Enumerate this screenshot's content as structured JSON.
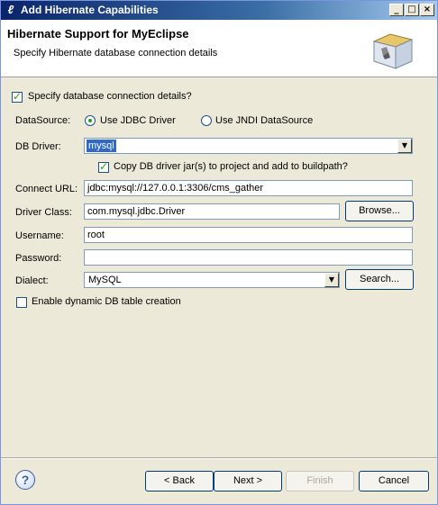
{
  "window": {
    "title": "Add Hibernate Capabilities",
    "controls": {
      "minimize": "_",
      "maximize": "□",
      "close": "×"
    }
  },
  "banner": {
    "heading": "Hibernate Support for MyEclipse",
    "subtitle": "Specify Hibernate database connection details"
  },
  "form": {
    "specify_details": {
      "label": "Specify database connection details?",
      "checked": true
    },
    "datasource": {
      "label": "DataSource:",
      "options": [
        {
          "label": "Use JDBC Driver",
          "checked": true
        },
        {
          "label": "Use JNDI DataSource",
          "checked": false
        }
      ]
    },
    "db_driver": {
      "label": "DB Driver:",
      "value": "mysql"
    },
    "copy_jars": {
      "label": "Copy DB driver jar(s) to project and add to buildpath?",
      "checked": true
    },
    "connect_url": {
      "label": "Connect URL:",
      "value": "jdbc:mysql://127.0.0.1:3306/cms_gather"
    },
    "driver_class": {
      "label": "Driver Class:",
      "value": "com.mysql.jdbc.Driver",
      "button": "Browse..."
    },
    "username": {
      "label": "Username:",
      "value": "root"
    },
    "password": {
      "label": "Password:",
      "value": ""
    },
    "dialect": {
      "label": "Dialect:",
      "value": "MySQL",
      "button": "Search..."
    },
    "dynamic_table": {
      "label": "Enable dynamic DB table creation",
      "checked": false
    }
  },
  "footer": {
    "help": "?",
    "back": "< Back",
    "next": "Next >",
    "finish": "Finish",
    "cancel": "Cancel"
  },
  "colors": {
    "titlebar": "#0a246a",
    "dialog_bg": "#ece9d8",
    "selection": "#316ac5",
    "check_mark": "#21a121"
  },
  "icons": [
    "wizard-banner-icon",
    "help-icon",
    "dropdown-arrow-icon",
    "window-app-icon"
  ]
}
